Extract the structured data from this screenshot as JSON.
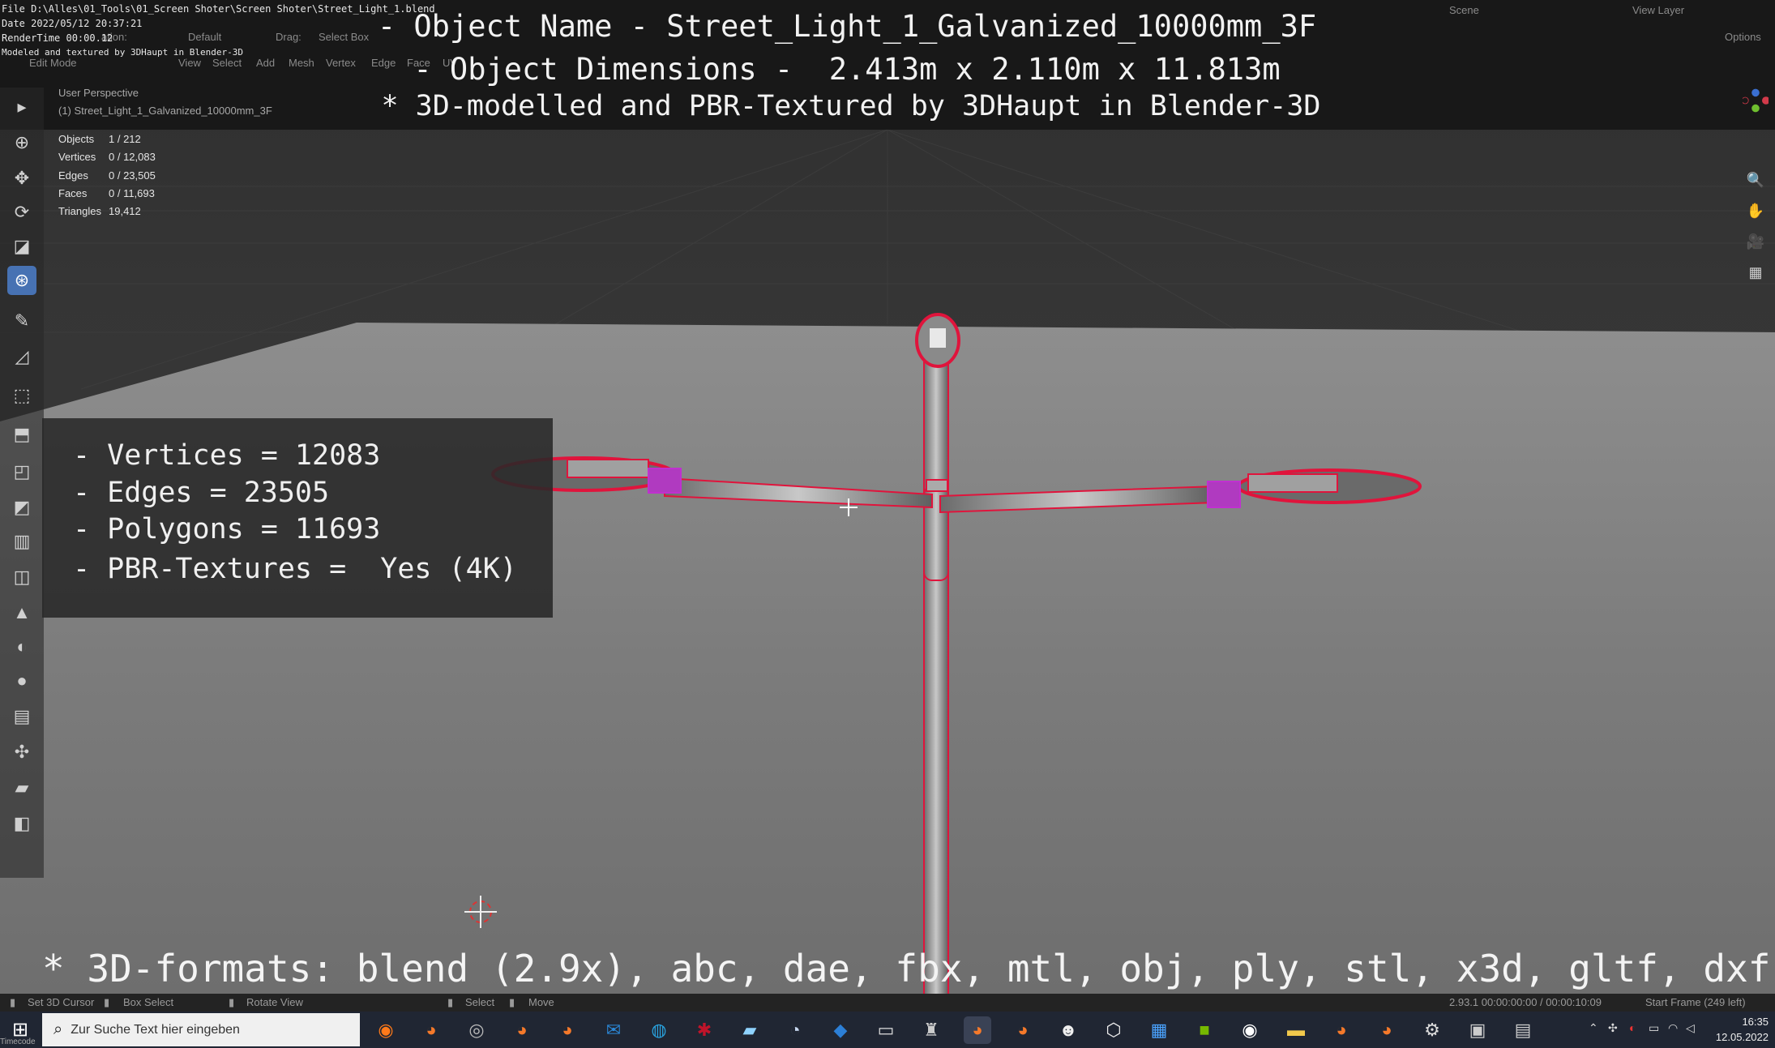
{
  "file_info": {
    "file": "File D:\\Alles\\01_Tools\\01_Screen Shoter\\Screen Shoter\\Street_Light_1.blend",
    "date": "Date 2022/05/12 20:37:21",
    "render_time": "RenderTime 00:00.12",
    "credit": "Modeled and textured by 3DHaupt in Blender-3D"
  },
  "title": {
    "line1": "- Object Name - Street_Light_1_Galvanized_10000mm_3F",
    "line2": "- Object Dimensions -  2.413m x 2.110m x 11.813m",
    "line3": "* 3D-modelled and PBR-Textured by 3DHaupt in Blender-3D"
  },
  "header": {
    "orientation_label": "ation:",
    "orientation_value": "Default",
    "drag_label": "Drag:",
    "drag_value": "Select Box",
    "mode": "Edit Mode",
    "menus": [
      "View",
      "Select",
      "Add",
      "Mesh",
      "Vertex",
      "Edge",
      "Face",
      "UV"
    ],
    "scene": "Scene",
    "view_layer": "View Layer",
    "options": "Options"
  },
  "viewport": {
    "perspective": "User Perspective",
    "object": "(1) Street_Light_1_Galvanized_10000mm_3F",
    "stats": [
      {
        "label": "Objects",
        "value": "1 / 212"
      },
      {
        "label": "Vertices",
        "value": "0 / 12,083"
      },
      {
        "label": "Edges",
        "value": "0 / 23,505"
      },
      {
        "label": "Faces",
        "value": "0 / 11,693"
      },
      {
        "label": "Triangles",
        "value": "19,412"
      }
    ]
  },
  "info_box": {
    "vertices": "- Vertices = 12083",
    "edges": "- Edges = 23505",
    "polygons": "- Polygons = 11693",
    "textures": "- PBR-Textures =  Yes (4K)"
  },
  "formats": "* 3D-formats: blend (2.9x), abc, dae, fbx, mtl, obj, ply, stl, x3d, gltf, dxf",
  "status_bar": {
    "set_cursor": "Set 3D Cursor",
    "box_select": "Box Select",
    "rotate_view": "Rotate View",
    "select": "Select",
    "move": "Move",
    "version": "2.93.1  00:00:00:00 / 00:00:10:09",
    "start_frame": "Start Frame (249 left)"
  },
  "taskbar": {
    "search_placeholder": "Zur Suche Text hier eingeben",
    "time": "16:35",
    "date": "12.05.2022",
    "timecode": "Timecode"
  },
  "colors": {
    "accent": "#4772b3",
    "selection": "#e0143c",
    "seam": "#c030d0"
  }
}
